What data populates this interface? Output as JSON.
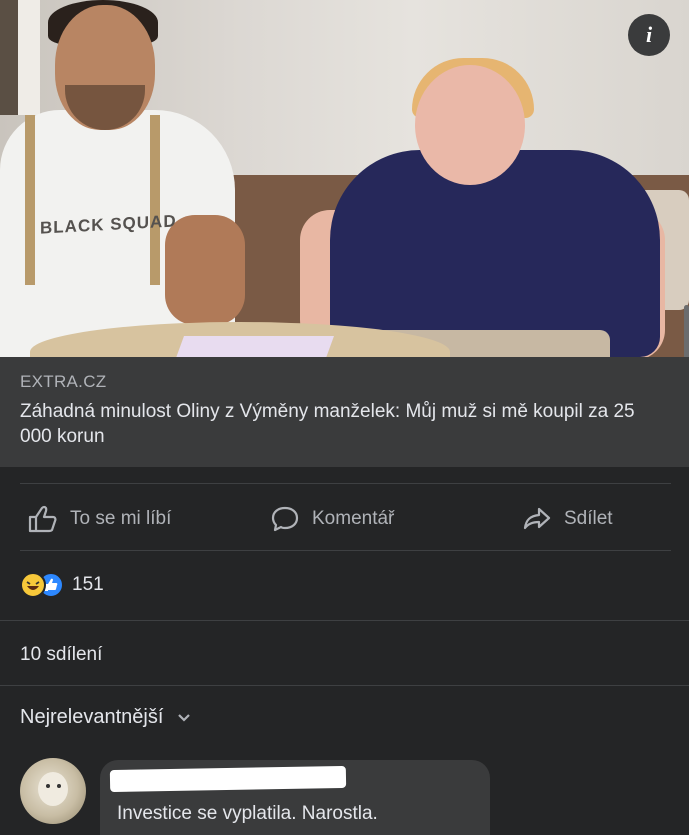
{
  "post": {
    "link_domain": "EXTRA.CZ",
    "link_title": "Záhadná minulost Oliny z Výměny manželek: Můj muž si mě koupil za 25 000 korun",
    "image_shirt_text": "BLACK SQUAD",
    "info_icon": "i"
  },
  "actions": {
    "like_label": "To se mi líbí",
    "comment_label": "Komentář",
    "share_label": "Sdílet"
  },
  "reactions": {
    "types": [
      "haha-icon",
      "like-icon"
    ],
    "count": "151"
  },
  "shares": {
    "label": "10 sdílení"
  },
  "comments": {
    "sort_label": "Nejrelevantnější",
    "items": [
      {
        "author": "",
        "text": "Investice se vyplatila. Narostla."
      }
    ]
  },
  "colors": {
    "background": "#242526",
    "card": "#3a3b3c",
    "text_primary": "#e4e6eb",
    "text_secondary": "#b0b3b8",
    "like_blue": "#2d88ff"
  }
}
